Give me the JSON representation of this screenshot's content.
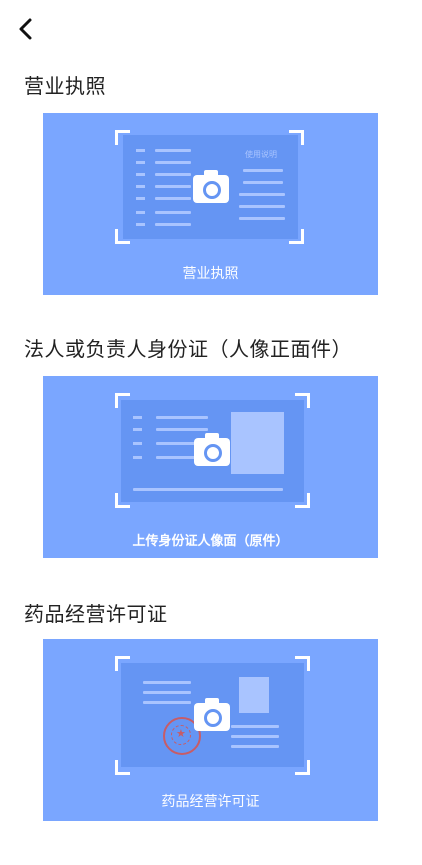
{
  "header": {
    "back_icon": "chevron-left-icon"
  },
  "sections": [
    {
      "title": "营业执照",
      "card_label": "营业执照",
      "hint": "使用说明"
    },
    {
      "title": "法人或负责人身份证（人像正面件）",
      "card_label": "上传身份证人像面（原件）"
    },
    {
      "title": "药品经营许可证",
      "card_label": "药品经营许可证"
    }
  ],
  "colors": {
    "card_bg": "#7aa6ff",
    "doc_bg": "#6595f3",
    "line": "#a9c4ff",
    "seal": "#d9534f"
  }
}
